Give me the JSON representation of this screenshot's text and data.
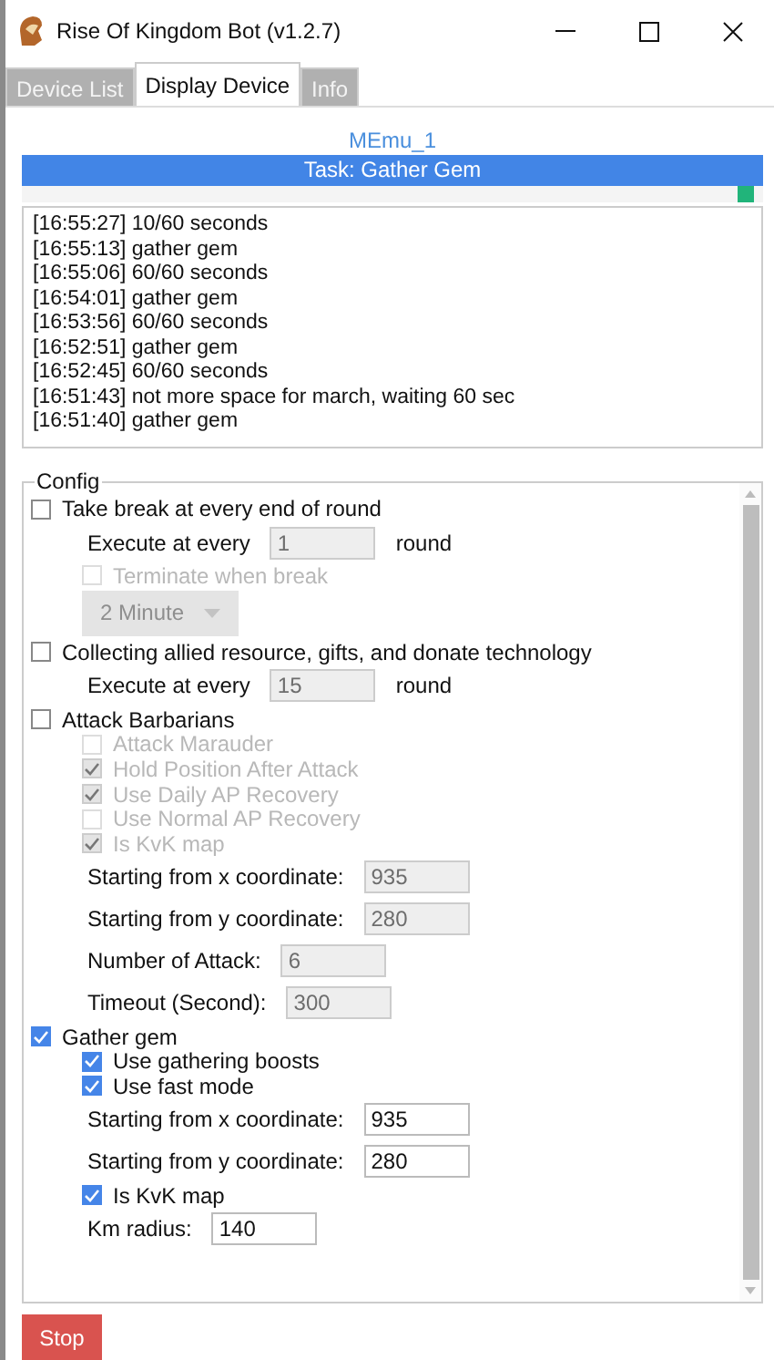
{
  "window": {
    "title": "Rise Of Kingdom Bot (v1.2.7)"
  },
  "tabs": [
    {
      "label": "Device List",
      "selected": false
    },
    {
      "label": "Display Device",
      "selected": true
    },
    {
      "label": "Info",
      "selected": false
    }
  ],
  "device": {
    "name": "MEmu_1",
    "task": "Task: Gather Gem"
  },
  "log": [
    "[16:55:27] 10/60 seconds",
    "[16:55:13] gather gem",
    "[16:55:06] 60/60 seconds",
    "[16:54:01] gather gem",
    "[16:53:56] 60/60 seconds",
    "[16:52:51] gather gem",
    "[16:52:45] 60/60 seconds",
    "[16:51:43] not more space for march, waiting 60 sec",
    "[16:51:40] gather gem"
  ],
  "config": {
    "title": "Config",
    "items": [
      {
        "kind": "checkbox",
        "label": "Take break at every end of round",
        "checked": false,
        "disabled": false,
        "children": [
          {
            "kind": "field",
            "label": "Execute at every",
            "value": "1",
            "unit": "round",
            "disabled": true
          },
          {
            "kind": "checkbox",
            "label": "Terminate when break",
            "checked": false,
            "disabled": true
          },
          {
            "kind": "dropdown",
            "value": "2 Minute",
            "disabled": true
          }
        ]
      },
      {
        "kind": "checkbox",
        "label": "Collecting allied resource, gifts, and donate technology",
        "checked": false,
        "disabled": false,
        "children": [
          {
            "kind": "field",
            "label": "Execute at every",
            "value": "15",
            "unit": "round",
            "disabled": true
          }
        ]
      },
      {
        "kind": "checkbox",
        "label": "Attack Barbarians",
        "checked": false,
        "disabled": false,
        "children": [
          {
            "kind": "checkbox",
            "label": "Attack Marauder",
            "checked": false,
            "disabled": true
          },
          {
            "kind": "checkbox",
            "label": "Hold Position After Attack",
            "checked": true,
            "disabled": true
          },
          {
            "kind": "checkbox",
            "label": "Use Daily AP Recovery",
            "checked": true,
            "disabled": true
          },
          {
            "kind": "checkbox",
            "label": "Use Normal AP Recovery",
            "checked": false,
            "disabled": true
          },
          {
            "kind": "checkbox",
            "label": "Is KvK map",
            "checked": true,
            "disabled": true
          },
          {
            "kind": "field",
            "label": "Starting from x coordinate:",
            "value": "935",
            "disabled": true
          },
          {
            "kind": "field",
            "label": "Starting from y coordinate:",
            "value": "280",
            "disabled": true
          },
          {
            "kind": "field",
            "label": "Number of Attack:",
            "value": "6",
            "disabled": true
          },
          {
            "kind": "field",
            "label": "Timeout (Second):",
            "value": "300",
            "disabled": true
          }
        ]
      },
      {
        "kind": "checkbox",
        "label": "Gather gem",
        "checked": true,
        "disabled": false,
        "children": [
          {
            "kind": "checkbox",
            "label": "Use gathering boosts",
            "checked": true,
            "disabled": false
          },
          {
            "kind": "checkbox",
            "label": "Use fast mode",
            "checked": true,
            "disabled": false
          },
          {
            "kind": "field",
            "label": "Starting from x coordinate:",
            "value": "935",
            "disabled": false
          },
          {
            "kind": "field",
            "label": "Starting from y coordinate:",
            "value": "280",
            "disabled": false
          },
          {
            "kind": "checkbox",
            "label": "Is KvK map",
            "checked": true,
            "disabled": false
          },
          {
            "kind": "field",
            "label": "Km radius:",
            "value": "140",
            "disabled": false
          }
        ]
      }
    ]
  },
  "buttons": [
    {
      "label": "Stop"
    }
  ]
}
